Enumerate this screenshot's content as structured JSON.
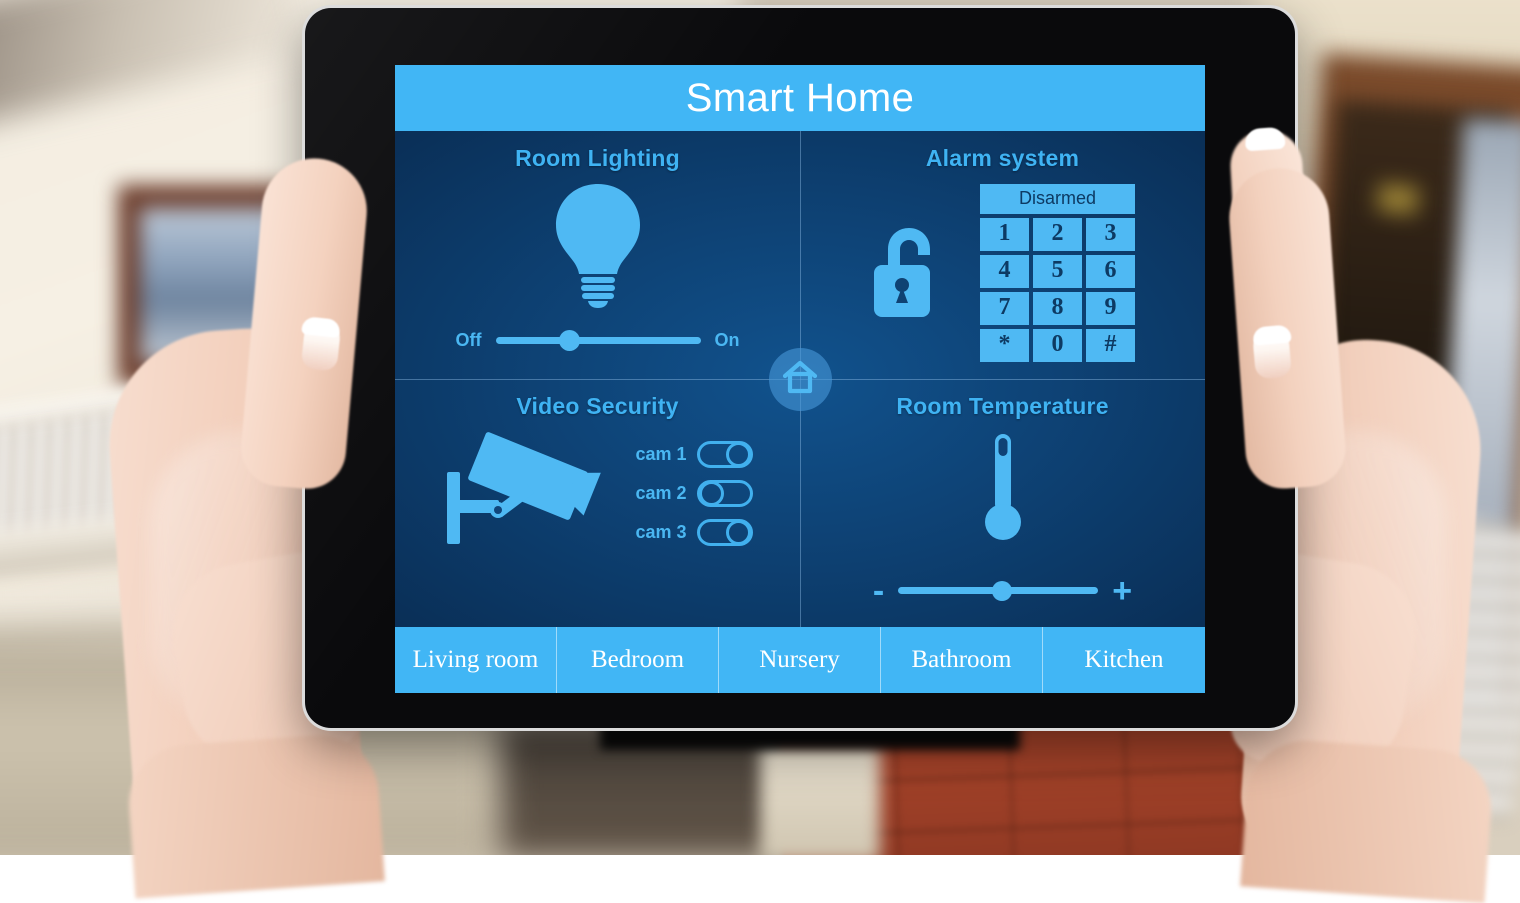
{
  "app": {
    "title": "Smart Home",
    "accent_light": "#41b6f5",
    "accent_icon": "#4fb9f3",
    "screen_bg_dark": "#0a2f57",
    "screen_bg_mid": "#11528d",
    "title_text_color": "#ffffff",
    "panel_title_color": "#3fb3f3"
  },
  "panels": {
    "lighting": {
      "title": "Room Lighting",
      "icon": "lightbulb-icon",
      "slider": {
        "min_label": "Off",
        "max_label": "On",
        "value_percent": 36
      }
    },
    "alarm": {
      "title": "Alarm system",
      "icon": "open-padlock-icon",
      "status": "Disarmed",
      "keys": [
        "1",
        "2",
        "3",
        "4",
        "5",
        "6",
        "7",
        "8",
        "9",
        "*",
        "0",
        "#"
      ]
    },
    "video": {
      "title": "Video Security",
      "icon": "cctv-camera-icon",
      "cameras": [
        {
          "label": "cam 1",
          "state": "on"
        },
        {
          "label": "cam 2",
          "state": "off"
        },
        {
          "label": "cam 3",
          "state": "on"
        }
      ]
    },
    "temperature": {
      "title": "Room Temperature",
      "icon": "thermometer-icon",
      "slider": {
        "min_label": "-",
        "max_label": "+",
        "value_percent": 52
      }
    }
  },
  "home_button": {
    "icon": "home-icon"
  },
  "tabs": [
    {
      "label": "Living room"
    },
    {
      "label": "Bedroom"
    },
    {
      "label": "Nursery"
    },
    {
      "label": "Bathroom"
    },
    {
      "label": "Kitchen"
    }
  ]
}
